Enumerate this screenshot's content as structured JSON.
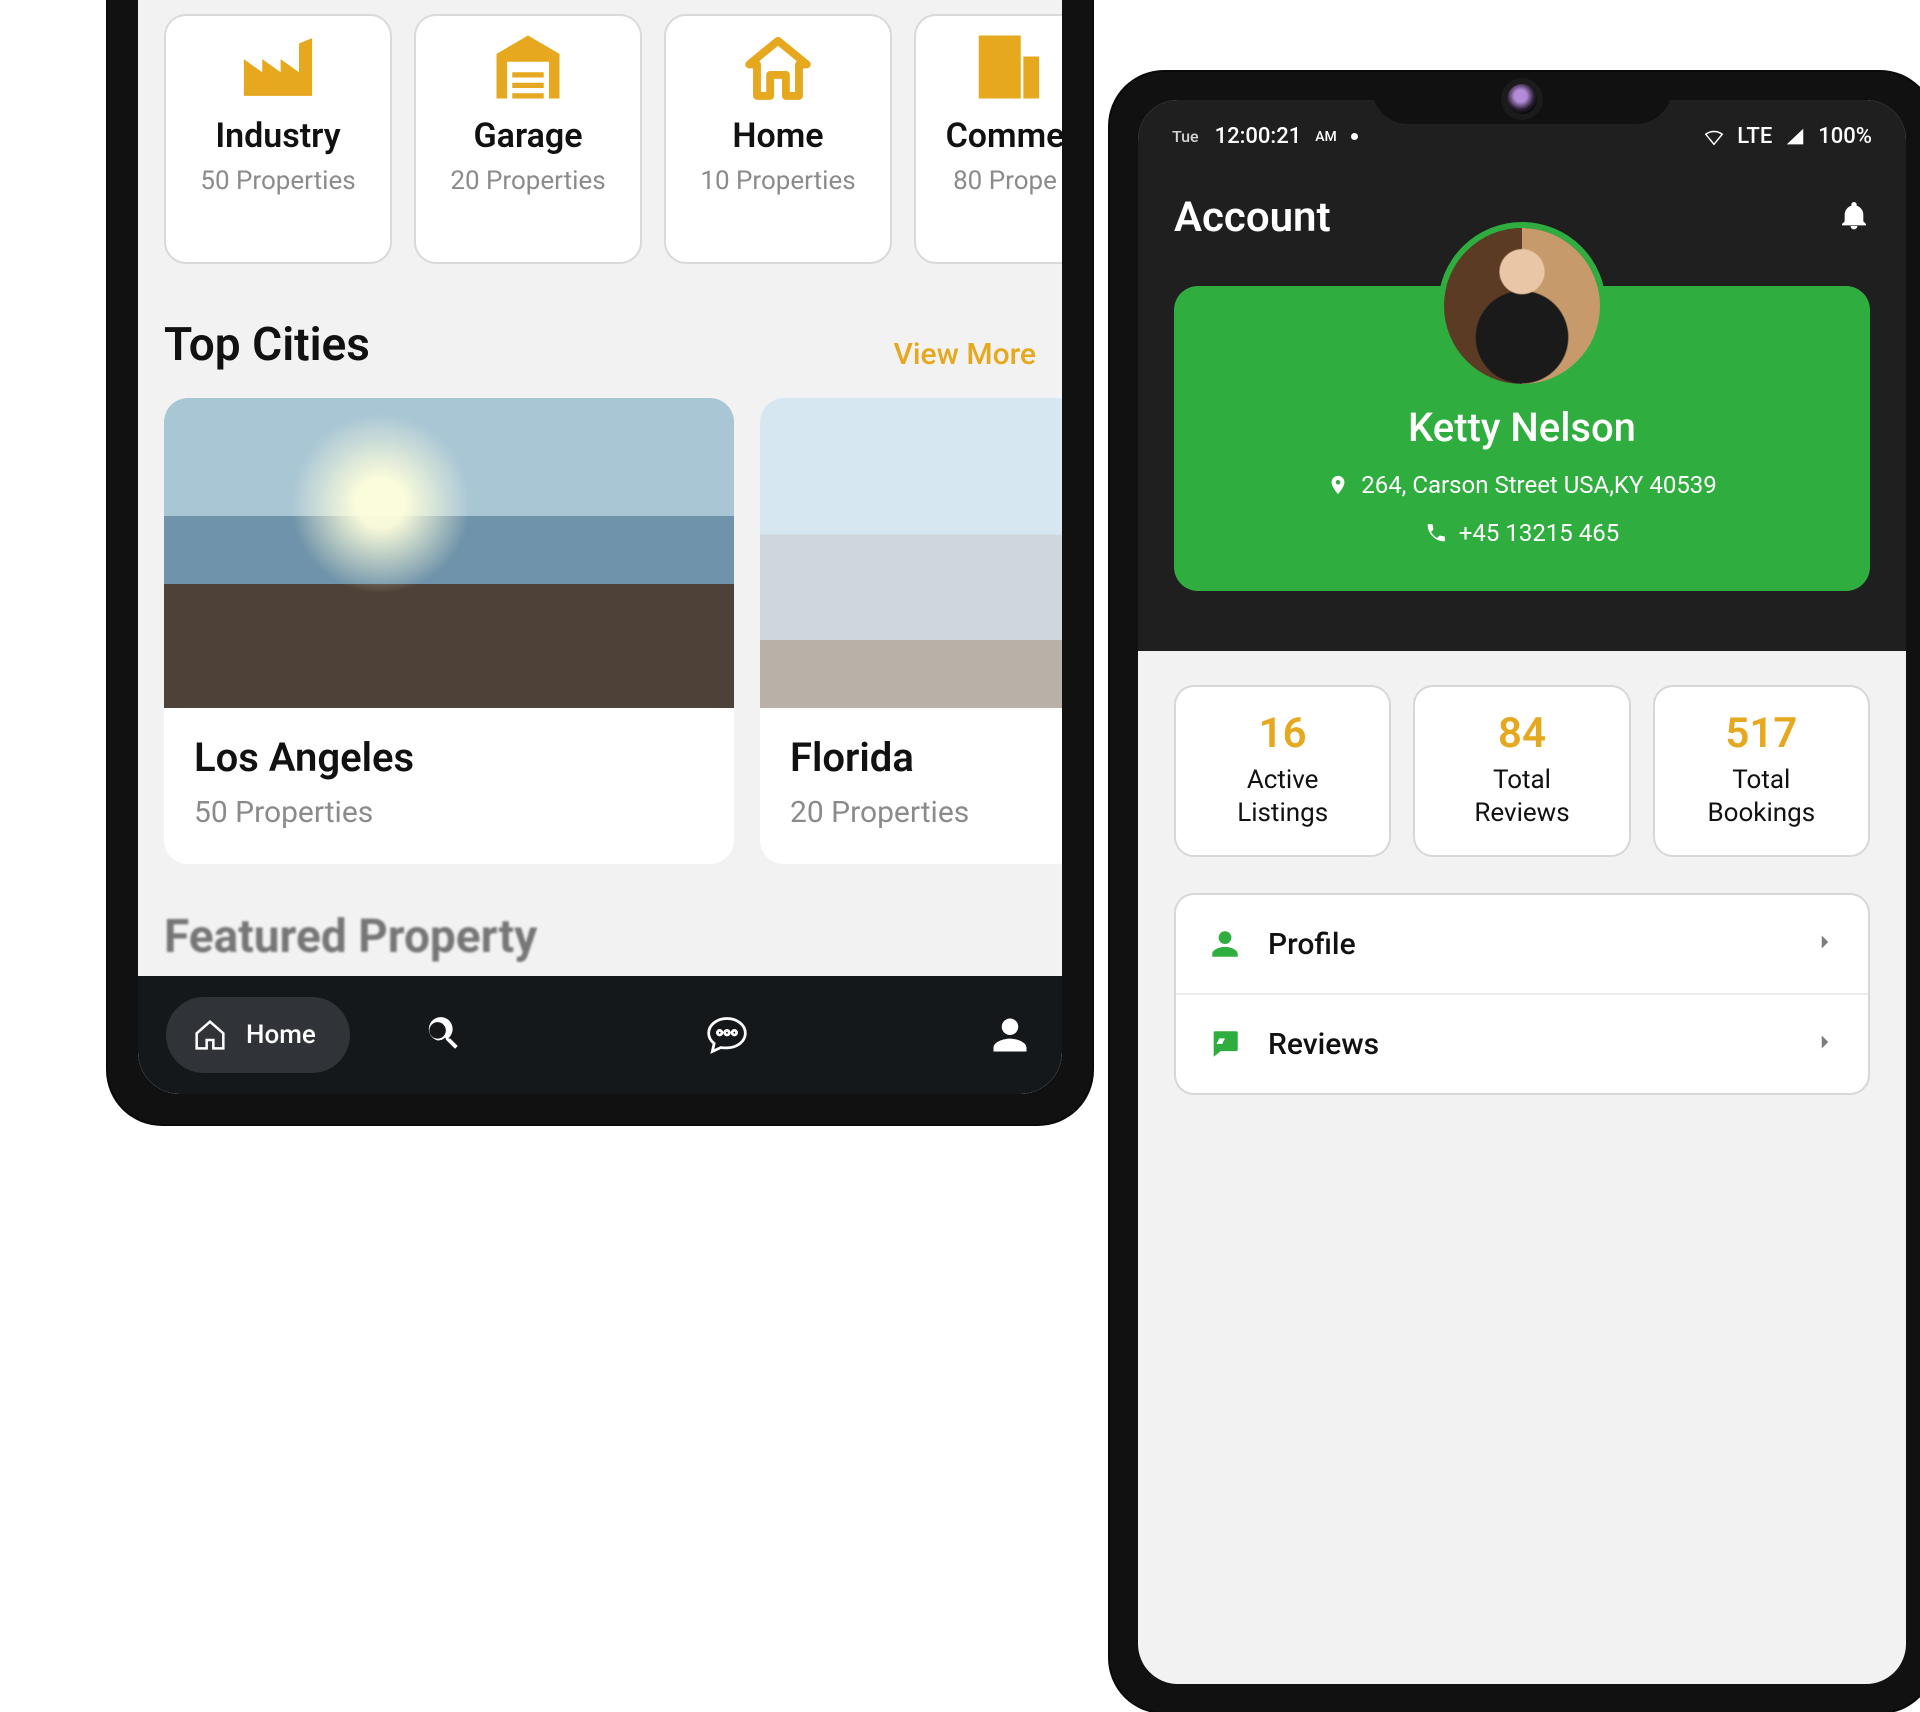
{
  "colors": {
    "accent_yellow": "#e6a81e",
    "accent_green": "#2fae3f"
  },
  "left": {
    "categories": [
      {
        "title": "Industry",
        "sub": "50 Properties",
        "icon": "industry"
      },
      {
        "title": "Garage",
        "sub": "20 Properties",
        "icon": "garage"
      },
      {
        "title": "Home",
        "sub": "10 Properties",
        "icon": "home"
      },
      {
        "title": "Comme",
        "sub": "80 Prope",
        "icon": "commerce"
      }
    ],
    "top_cities_heading": "Top Cities",
    "view_more": "View More",
    "cities": [
      {
        "name": "Los Angeles",
        "sub": "50 Properties"
      },
      {
        "name": "Florida",
        "sub": "20 Properties"
      }
    ],
    "featured_heading": "Featured Property",
    "nav": {
      "home": "Home"
    }
  },
  "right": {
    "status": {
      "day": "Tue",
      "time": "12:00:21",
      "ampm": "AM",
      "net": "LTE",
      "battery": "100%"
    },
    "header": {
      "title": "Account"
    },
    "profile": {
      "name": "Ketty Nelson",
      "address": "264, Carson Street USA,KY 40539",
      "phone": "+45 13215 465"
    },
    "stats": [
      {
        "value": "16",
        "label_line1": "Active",
        "label_line2": "Listings"
      },
      {
        "value": "84",
        "label_line1": "Total",
        "label_line2": "Reviews"
      },
      {
        "value": "517",
        "label_line1": "Total",
        "label_line2": "Bookings"
      }
    ],
    "menu": [
      {
        "label": "Profile",
        "icon": "person"
      },
      {
        "label": "Reviews",
        "icon": "review"
      }
    ]
  }
}
